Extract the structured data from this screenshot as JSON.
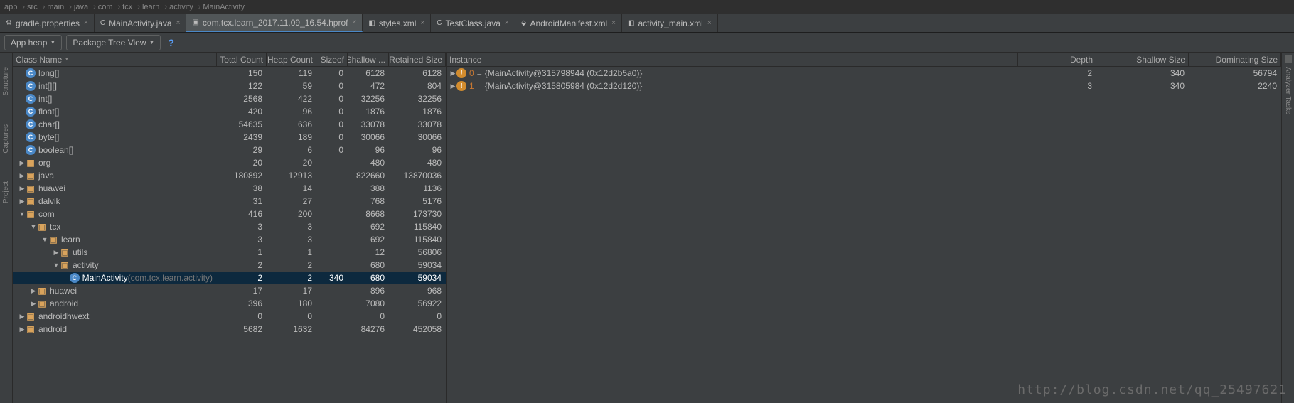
{
  "breadcrumbs": [
    "app",
    "src",
    "main",
    "java",
    "com",
    "tcx",
    "learn",
    "activity",
    "MainActivity"
  ],
  "tabs": [
    {
      "label": "gradle.properties",
      "icon": "⚙",
      "active": false
    },
    {
      "label": "MainActivity.java",
      "icon": "C",
      "active": false
    },
    {
      "label": "com.tcx.learn_2017.11.09_16.54.hprof",
      "icon": "▣",
      "active": true
    },
    {
      "label": "styles.xml",
      "icon": "◧",
      "active": false
    },
    {
      "label": "TestClass.java",
      "icon": "C",
      "active": false
    },
    {
      "label": "AndroidManifest.xml",
      "icon": "⬙",
      "active": false
    },
    {
      "label": "activity_main.xml",
      "icon": "◧",
      "active": false
    }
  ],
  "toolbar": {
    "heap_label": "App heap",
    "view_label": "Package Tree View"
  },
  "headers_left": {
    "name": "Class Name",
    "total": "Total Count",
    "heap": "Heap Count",
    "sizeof": "Sizeof",
    "shallow": "Shallow ...",
    "retained": "Retained Size"
  },
  "headers_right": {
    "instance": "Instance",
    "depth": "Depth",
    "shallow": "Shallow Size",
    "dominating": "Dominating Size"
  },
  "left_rows": [
    {
      "indent": 0,
      "exp": "",
      "icon": "class",
      "label": "long[]",
      "total": "150",
      "heap": "119",
      "sizeof": "0",
      "shallow": "6128",
      "retained": "6128"
    },
    {
      "indent": 0,
      "exp": "",
      "icon": "class",
      "label": "int[][]",
      "total": "122",
      "heap": "59",
      "sizeof": "0",
      "shallow": "472",
      "retained": "804"
    },
    {
      "indent": 0,
      "exp": "",
      "icon": "class",
      "label": "int[]",
      "total": "2568",
      "heap": "422",
      "sizeof": "0",
      "shallow": "32256",
      "retained": "32256"
    },
    {
      "indent": 0,
      "exp": "",
      "icon": "class",
      "label": "float[]",
      "total": "420",
      "heap": "96",
      "sizeof": "0",
      "shallow": "1876",
      "retained": "1876"
    },
    {
      "indent": 0,
      "exp": "",
      "icon": "class",
      "label": "char[]",
      "total": "54635",
      "heap": "636",
      "sizeof": "0",
      "shallow": "33078",
      "retained": "33078"
    },
    {
      "indent": 0,
      "exp": "",
      "icon": "class",
      "label": "byte[]",
      "total": "2439",
      "heap": "189",
      "sizeof": "0",
      "shallow": "30066",
      "retained": "30066"
    },
    {
      "indent": 0,
      "exp": "",
      "icon": "class",
      "label": "boolean[]",
      "total": "29",
      "heap": "6",
      "sizeof": "0",
      "shallow": "96",
      "retained": "96"
    },
    {
      "indent": 0,
      "exp": "▶",
      "icon": "pkg",
      "label": "org",
      "total": "20",
      "heap": "20",
      "sizeof": "",
      "shallow": "480",
      "retained": "480"
    },
    {
      "indent": 0,
      "exp": "▶",
      "icon": "pkg",
      "label": "java",
      "total": "180892",
      "heap": "12913",
      "sizeof": "",
      "shallow": "822660",
      "retained": "13870036"
    },
    {
      "indent": 0,
      "exp": "▶",
      "icon": "pkg",
      "label": "huawei",
      "total": "38",
      "heap": "14",
      "sizeof": "",
      "shallow": "388",
      "retained": "1136"
    },
    {
      "indent": 0,
      "exp": "▶",
      "icon": "pkg",
      "label": "dalvik",
      "total": "31",
      "heap": "27",
      "sizeof": "",
      "shallow": "768",
      "retained": "5176"
    },
    {
      "indent": 0,
      "exp": "▼",
      "icon": "pkg",
      "label": "com",
      "total": "416",
      "heap": "200",
      "sizeof": "",
      "shallow": "8668",
      "retained": "173730"
    },
    {
      "indent": 1,
      "exp": "▼",
      "icon": "pkg",
      "label": "tcx",
      "total": "3",
      "heap": "3",
      "sizeof": "",
      "shallow": "692",
      "retained": "115840"
    },
    {
      "indent": 2,
      "exp": "▼",
      "icon": "pkg",
      "label": "learn",
      "total": "3",
      "heap": "3",
      "sizeof": "",
      "shallow": "692",
      "retained": "115840"
    },
    {
      "indent": 3,
      "exp": "▶",
      "icon": "pkg",
      "label": "utils",
      "total": "1",
      "heap": "1",
      "sizeof": "",
      "shallow": "12",
      "retained": "56806"
    },
    {
      "indent": 3,
      "exp": "▼",
      "icon": "pkg",
      "label": "activity",
      "total": "2",
      "heap": "2",
      "sizeof": "",
      "shallow": "680",
      "retained": "59034"
    },
    {
      "indent": 4,
      "exp": "",
      "icon": "class",
      "label": "MainActivity",
      "dimlabel": " (com.tcx.learn.activity)",
      "total": "2",
      "heap": "2",
      "sizeof": "340",
      "shallow": "680",
      "retained": "59034",
      "selected": true
    },
    {
      "indent": 1,
      "exp": "▶",
      "icon": "pkg",
      "label": "huawei",
      "total": "17",
      "heap": "17",
      "sizeof": "",
      "shallow": "896",
      "retained": "968"
    },
    {
      "indent": 1,
      "exp": "▶",
      "icon": "pkg",
      "label": "android",
      "total": "396",
      "heap": "180",
      "sizeof": "",
      "shallow": "7080",
      "retained": "56922"
    },
    {
      "indent": 0,
      "exp": "▶",
      "icon": "pkg",
      "label": "androidhwext",
      "total": "0",
      "heap": "0",
      "sizeof": "",
      "shallow": "0",
      "retained": "0"
    },
    {
      "indent": 0,
      "exp": "▶",
      "icon": "pkg",
      "label": "android",
      "total": "5682",
      "heap": "1632",
      "sizeof": "",
      "shallow": "84276",
      "retained": "452058"
    }
  ],
  "right_rows": [
    {
      "idx": "0",
      "text": "{MainActivity@315798944 (0x12d2b5a0)}",
      "depth": "2",
      "shallow": "340",
      "dom": "56794"
    },
    {
      "idx": "1",
      "text": "{MainActivity@315805984 (0x12d2d120)}",
      "depth": "3",
      "shallow": "340",
      "dom": "2240"
    }
  ],
  "sidebar_left": [
    "Structure",
    "Captures",
    "Project"
  ],
  "sidebar_right_label": "Analyzer Tasks",
  "watermark": "http://blog.csdn.net/qq_25497621"
}
